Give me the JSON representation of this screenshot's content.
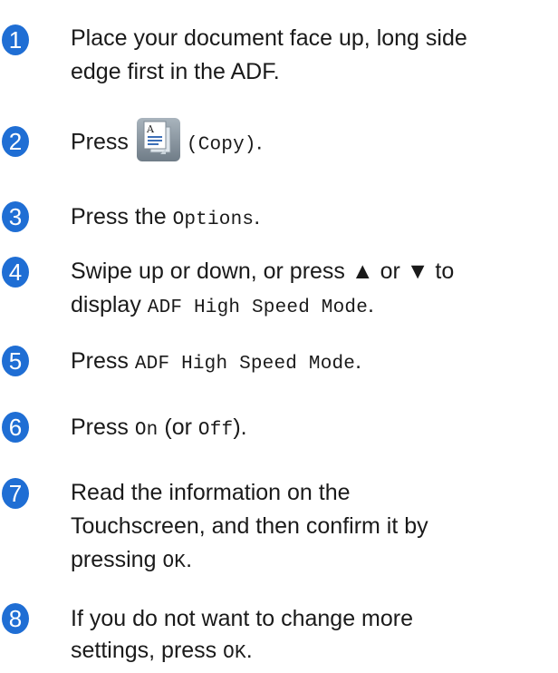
{
  "steps": [
    {
      "number": "1",
      "line1": "Place your document face up, long side",
      "line2": "edge first in the ADF."
    },
    {
      "number": "2",
      "pre": "Press",
      "icon": "copy-icon",
      "icon_letter": "A",
      "code": "(Copy)",
      "post": "."
    },
    {
      "number": "3",
      "pre": "Press the ",
      "code": "Options",
      "post": "."
    },
    {
      "number": "4",
      "line1": "Swipe up or down, or press ▲ or ▼ to",
      "line2_pre": "display ",
      "line2_code": "ADF High Speed Mode",
      "line2_post": "."
    },
    {
      "number": "5",
      "pre": "Press ",
      "code": "ADF High Speed Mode",
      "post": "."
    },
    {
      "number": "6",
      "pre": "Press ",
      "code1": "On",
      "mid": " (or ",
      "code2": "Off",
      "post": ")."
    },
    {
      "number": "7",
      "line1": "Read the information on the",
      "line2": "Touchscreen, and then confirm it by",
      "line3_pre": "pressing ",
      "line3_code": "OK",
      "line3_post": "."
    },
    {
      "number": "8",
      "line1": "If you do not want to change more",
      "line2_pre": "settings, press ",
      "line2_code": "OK",
      "line2_post": "."
    }
  ],
  "colors": {
    "step_circle": "#1f6ed4",
    "text": "#1a1a1a"
  }
}
